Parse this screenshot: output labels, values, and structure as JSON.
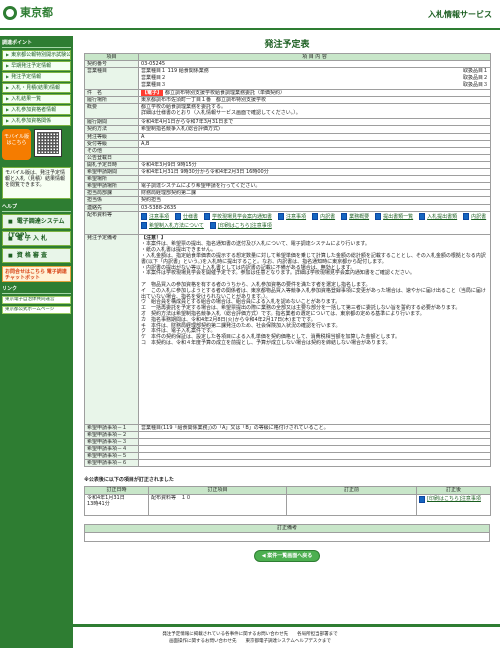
{
  "header": {
    "logo_text": "東京都",
    "right_link": "入札情報サービス"
  },
  "sidebar": {
    "menu_title": "調達ポイント",
    "items": [
      "東京都公報特別開示試験公告",
      "早期発注予定情報",
      "発注予定情報",
      "入札・見積(結果)情報",
      "入札結果一覧",
      "入札参加資格者情報",
      "入札参加資格関係"
    ],
    "mobile_badge": "モバイル版はこちら",
    "mobile_note": "モバイル版は、発注予定情報と入札（見積）結果情報を閲覧できます。",
    "help_title": "ヘルプ",
    "big_buttons": [
      "電子調達システム(TOP)",
      "電 子 入 札",
      "資 格 審 査"
    ],
    "calendar_text": "お問合せはこちら\n電子調達チャットボット",
    "small_buttons": [
      "東京電子自治体共同運営",
      "東京都公式ホームページ"
    ],
    "link_section": "リンク"
  },
  "main": {
    "title": "発注予定表",
    "column_item": "項目",
    "column_content": "項 目 内 容",
    "rows": [
      {
        "label": "契約番号",
        "value": "03-05245"
      },
      {
        "label": "営業種目",
        "lines": [
          {
            "left": "営業種目１ 119 給食関係業務",
            "right": "取扱品目１"
          },
          {
            "left": "営業種目２",
            "right": "取扱品目２"
          },
          {
            "left": "営業種目３",
            "right": "取扱品目３"
          }
        ]
      },
      {
        "label": "件　名",
        "prefix": "【電子】",
        "value": "都立調布特別支援学校給食調理業務委託（単価契約）"
      },
      {
        "label": "履行場所",
        "value": "東京都調布市佐須町一丁目１番　都立調布特別支援学校"
      },
      {
        "label": "概要",
        "value": "都立学校の給食調理業務を委託する。\n詳細は仕様書のとおり（入札情報サービス画面で確認してください。）。"
      },
      {
        "label": "履行期間",
        "value": "令和4年4月1日から令和7年3月31日まで"
      },
      {
        "label": "契約方法",
        "value": "希望制指名競争入札(総合評価方式)"
      },
      {
        "label": "発注等級",
        "value": "A"
      },
      {
        "label": "受付等級",
        "value": "A,B"
      },
      {
        "label": "その他",
        "value": ""
      },
      {
        "label": "公告登載日",
        "value": ""
      },
      {
        "label": "開札予定日時",
        "value": "令和4年3月9日 9時15分"
      },
      {
        "label": "希望申請期間",
        "value": "令和4年1月31日 9時30分から令和4年2月3日 16時00分"
      },
      {
        "label": "希望場所",
        "value": ""
      },
      {
        "label": "希望申請場所",
        "value": "電子調達システムにより希望申請を行ってください。"
      },
      {
        "label": "担当局部課",
        "value": "財務局経理部契約第二課"
      },
      {
        "label": "担当係",
        "value": "契約担当"
      },
      {
        "label": "連絡先",
        "value": "03-5388-2635"
      }
    ],
    "documents_label": "配布資料等",
    "documents": [
      "注意事項",
      "仕様書",
      "学校現場見学会案内通知書",
      "注意事項",
      "内訳書",
      "業務概要",
      "提出書類一覧",
      "入札提出書類",
      "内訳書",
      "希望制入札方法について",
      "[印刷はこちら]注意事項"
    ],
    "remarks_label": "発注予定備考",
    "remarks_title": "【注意！】",
    "remarks_text": "・本案件は、希望票の提出、指名通知書の送付及び入札について、電子調達システムにより行います。\n・紙の入札書は提出できません。\n・入札金額は、指定給食単価表の提示する想定数量に対して希望単価を乗じて計算した金額の総計額を記載することとし、その入札金額の根拠となる内訳書(以下「内訳書」という。)を入札時に提出すること。なお、内訳書は、指名通知時に東京都から配付します。\n・内訳書の提出がない等以上入札書としては内訳書の記載に不備がある場合は、無効とします。\n・本案件は学校現場見学会を開催予定です。参加は任意となります。詳細は学校現場見学会案内通知書をご確認ください。\n\nア　物品買入の参加資格を有する者のうちから、入札参加資格の要件を満たす者を選定し指名します。\nイ　この入札に参加しようとする者の関係者は、東京都物品買入等競争入札参加資格登録事項に変更があった場合は、速やかに届け出ること（当局に届け出ていない場合、指名を受けられないことがあります。）。\nウ　組合員を構成員とする組合の場合は、組合員による入札を認めないことがあります。\nエ　一括再委託を予定する場合は、希望票提出の際に業務の全部又は主要な部分を一括して第三者に委託しない旨を誓約する必要があります。\nオ　契約方法は希望制指名競争入札（総合評価方式）です。指名業者の選定については、東京都の定める基準により行います。\nカ　指名事務期間は、令和4年2月8日(火)から令和4年2月17日(木)までです。\nキ　本件は、財務局経理部契約第二課発注のため、社会保険加入状況の確認を行います。\nク　本件は、電子入札案件です。\nケ　本件の契約保証は、設定した各項目による入札単価を契約価格として、消費税相当額を加算した金額とします。\nコ　本契約は、令和４年度予算の成立を前提とし、予算が成立しない場合は契約を締結しない場合があります。",
    "hope_rows": [
      {
        "label": "希望申請事項－１",
        "value": "営業種目(119「給食関係業務」)の「A」又は「B」の等級に格付けされていること。"
      },
      {
        "label": "希望申請事項－２",
        "value": ""
      },
      {
        "label": "希望申請事項－３",
        "value": ""
      },
      {
        "label": "希望申請事項－４",
        "value": ""
      },
      {
        "label": "希望申請事項－５",
        "value": ""
      },
      {
        "label": "希望申請事項－６",
        "value": ""
      }
    ]
  },
  "update": {
    "section_title": "※公表後に以下の項目が訂正されました",
    "headers": [
      "訂正日時",
      "訂正項目",
      "訂正前",
      "訂正後"
    ],
    "date": "令和4年1月31日\n13時41分",
    "item": "配布資料等　１０",
    "before": "",
    "after": "[印刷はこちら]注意事項"
  },
  "remarks": {
    "header": "訂正備考",
    "value": ""
  },
  "return_button": "◀ 案件一覧画面へ戻る",
  "footer": {
    "line1": "発注予定情報に掲載されている各事件に関するお問い合わせ先　　各局所担当部署まで",
    "line2": "画面操作に関するお問い合わせ先　　東京都電子調達システムヘルプデスクまで"
  }
}
